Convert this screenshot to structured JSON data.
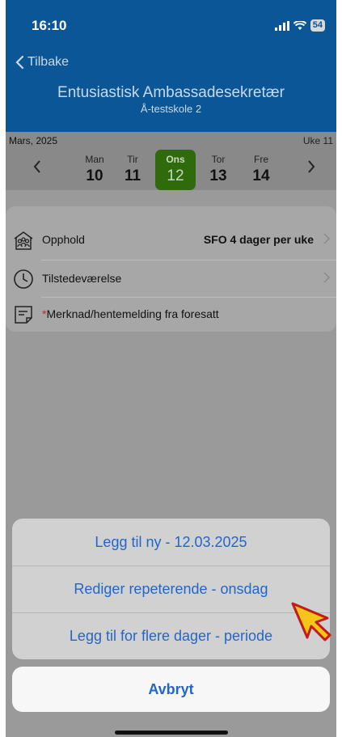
{
  "status_bar": {
    "time": "16:10",
    "battery": "54"
  },
  "nav": {
    "back_label": "Tilbake",
    "title": "Entusiastisk Ambassadesekretær",
    "subtitle": "Å-testskole 2"
  },
  "week_bar": {
    "month": "Mars, 2025",
    "week": "Uke 11",
    "days": [
      {
        "name": "Man",
        "date": "10"
      },
      {
        "name": "Tir",
        "date": "11"
      },
      {
        "name": "Ons",
        "date": "12",
        "selected": true
      },
      {
        "name": "Tor",
        "date": "13"
      },
      {
        "name": "Fre",
        "date": "14"
      }
    ]
  },
  "details": {
    "stay_label": "Opphold",
    "stay_value": "SFO 4 dager per uke",
    "attendance_label": "Tilstedeværelse",
    "note_required_mark": "*",
    "note_label": "Merknad/hentemelding fra foresatt"
  },
  "action_sheet": {
    "add_new": "Legg til ny - 12.03.2025",
    "edit_repeating": "Rediger repeterende - onsdag",
    "add_multiple": "Legg til for flere dager - periode",
    "cancel": "Avbryt"
  },
  "colors": {
    "header": "#0a5696",
    "selected_day": "#2f6a0c",
    "action_text": "#2366c9",
    "cursor": "#f5c518"
  }
}
